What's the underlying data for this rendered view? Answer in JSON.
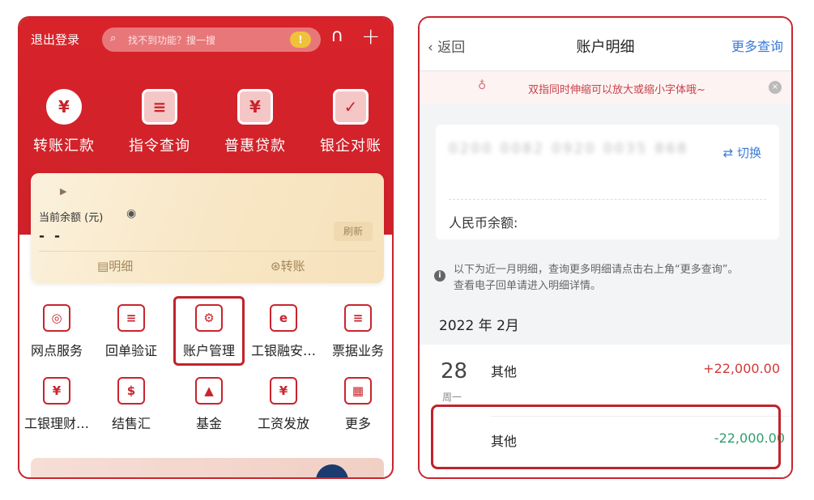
{
  "left": {
    "logout": "退出登录",
    "search_placeholder": "找不到功能？搜一搜",
    "top_features": [
      {
        "label": "转账汇款",
        "icon": "yen-transfer-icon",
        "glyph": "¥"
      },
      {
        "label": "指令查询",
        "icon": "query-doc-icon",
        "glyph": "≡"
      },
      {
        "label": "普惠贷款",
        "icon": "loan-icon",
        "glyph": "¥"
      },
      {
        "label": "银企对账",
        "icon": "reconcile-icon",
        "glyph": "✓"
      }
    ],
    "balance_card": {
      "label": "当前余额 (元)",
      "value": "- -",
      "refresh": "刷新",
      "detail_action": "明细",
      "transfer_action": "转账"
    },
    "grid_row1": [
      {
        "label": "网点服务",
        "glyph": "◎"
      },
      {
        "label": "回单验证",
        "glyph": "≡"
      },
      {
        "label": "账户管理",
        "glyph": "⚙"
      },
      {
        "label": "工银融安…",
        "glyph": "e"
      },
      {
        "label": "票据业务",
        "glyph": "≡"
      }
    ],
    "grid_row2": [
      {
        "label": "工银理财…",
        "glyph": "¥"
      },
      {
        "label": "结售汇",
        "glyph": "$"
      },
      {
        "label": "基金",
        "glyph": "▲"
      },
      {
        "label": "工资发放",
        "glyph": "¥"
      },
      {
        "label": "更多",
        "glyph": "▦"
      }
    ]
  },
  "right": {
    "back": "返回",
    "title": "账户明细",
    "more_query": "更多查询",
    "tip": "双指同时伸缩可以放大或缩小字体哦~",
    "account_number": "0200 0082 0920 0035 868",
    "switch": "切换",
    "rmb_balance_label": "人民币余额:",
    "info_line1": "以下为近一月明细，查询更多明细请点击右上角“更多查询”。",
    "info_line2": "查看电子回单请进入明细详情。",
    "month": "2022 年 2月",
    "day": "28",
    "weekday": "周一",
    "transactions": [
      {
        "type": "其他",
        "amount": "+22,000.00"
      },
      {
        "type": "其他",
        "amount": "-22,000.00"
      }
    ]
  }
}
